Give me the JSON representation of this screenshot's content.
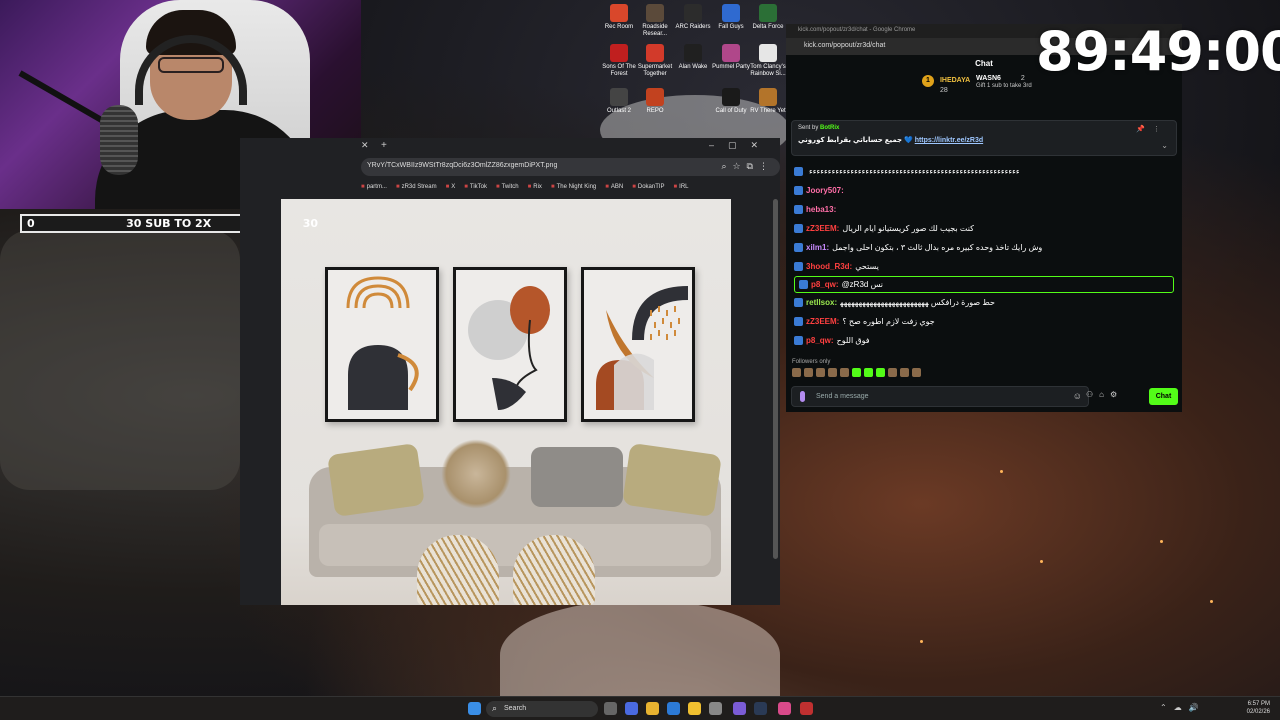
{
  "overlay": {
    "timer": "89:49:00",
    "sub_goal": {
      "left": "0",
      "label": "30 SUB TO 2X",
      "right": "30"
    }
  },
  "desktop_icons": [
    {
      "label": "Rec Room",
      "color": "#d9472b"
    },
    {
      "label": "Roadside Resear...",
      "color": "#5b4a3a"
    },
    {
      "label": "ARC Raiders",
      "color": "#2c2c2c"
    },
    {
      "label": "Fall Guys",
      "color": "#2f6ad0"
    },
    {
      "label": "Delta Force",
      "color": "#2b6f36"
    },
    {
      "label": "Sons Of The Forest",
      "color": "#c01f1f"
    },
    {
      "label": "Supermarket Together",
      "color": "#d23a2a"
    },
    {
      "label": "Alan Wake",
      "color": "#202020"
    },
    {
      "label": "Pummel Party",
      "color": "#b0478a"
    },
    {
      "label": "Tom Clancy's Rainbow Si...",
      "color": "#e6e6e6"
    },
    {
      "label": "Outlast 2",
      "color": "#444444"
    },
    {
      "label": "REPO",
      "color": "#c2421f"
    },
    {
      "label": "Call of Duty",
      "color": "#1a1a1a"
    },
    {
      "label": "RV There Yet",
      "color": "#b3742a"
    }
  ],
  "image_window": {
    "url": "YRvY/TCxWBIIz9WStTr8zqDci6z3OmlZZ86zxgemDiPXT.png",
    "bookmarks": [
      "partm...",
      "zR3d Stream",
      "X",
      "TikTok",
      "Twitch",
      "Rix",
      "The Night King",
      "ABN",
      "DokanTIP",
      "IRL"
    ]
  },
  "chat_window": {
    "window_title": "kick.com/popout/zr3d/chat - Google Chrome",
    "address": "kick.com/popout/zr3d/chat",
    "header": "Chat",
    "gifters": [
      {
        "rank": "1",
        "name": "IHEDAYA",
        "count": "28"
      },
      {
        "rank": "",
        "name": "WASN6",
        "count": "2"
      }
    ],
    "gift_note": "Gift 1 sub to take 3rd",
    "pinned": {
      "sent_by_label": "Sent by",
      "sent_by_user": "BotRix",
      "message": "جميع حساباتي بقرابط كوروني",
      "link": "https://linktr.ee/zR3d"
    },
    "messages": [
      {
        "user": "",
        "text": "ﺀﺀﺀﺀﺀﺀﺀﺀﺀﺀﺀﺀﺀﺀﺀﺀﺀﺀﺀﺀﺀﺀﺀﺀﺀﺀﺀﺀﺀﺀﺀﺀﺀﺀﺀﺀﺀﺀﺀﺀﺀﺀﺀﺀﺀﺀﺀﺀﺀﺀﺀﺀﺀﺀﺀﺀ",
        "color": "#ffffff"
      },
      {
        "user": "Joory507:",
        "text": "",
        "color": "#ff6fa8"
      },
      {
        "user": "heba13:",
        "text": "",
        "color": "#ff6fa8"
      },
      {
        "user": "zZ3EEM:",
        "text": "كنت بجيب لك صور كريستيانو ايام الريال",
        "color": "#ff4040"
      },
      {
        "user": "xilm1:",
        "text": "وش رايك تاخذ وحده كبيره مره بدال ثالث ٣ ، بتكون احلى واجمل",
        "color": "#c98bff"
      },
      {
        "user": "3hood_R3d:",
        "text": "يستحي",
        "color": "#ff4040"
      },
      {
        "user": "p8_qw:",
        "text": "@zR3d نس",
        "color": "#ff4040"
      },
      {
        "user": "retllsox:",
        "text": "حط صورة درافكس ﻬﻬﻬﻬﻬﻬﻬﻬﻬﻬﻬﻬﻬﻬﻬﻬﻬﻬﻬﻬﻬﻬﻬﻬ",
        "color": "#9be94f"
      },
      {
        "user": "zZ3EEM:",
        "text": "جوي زفت لازم اطوره صح ؟",
        "color": "#ff4040"
      },
      {
        "user": "p8_qw:",
        "text": "فوق اللوح",
        "color": "#ff4040"
      }
    ],
    "followers_only": "Followers only",
    "input_placeholder": "Send a message",
    "send_label": "Chat",
    "accent": "#53fc18"
  },
  "taskbar": {
    "search_label": "Search",
    "time": "6:57 PM",
    "date": "02/02/26"
  }
}
